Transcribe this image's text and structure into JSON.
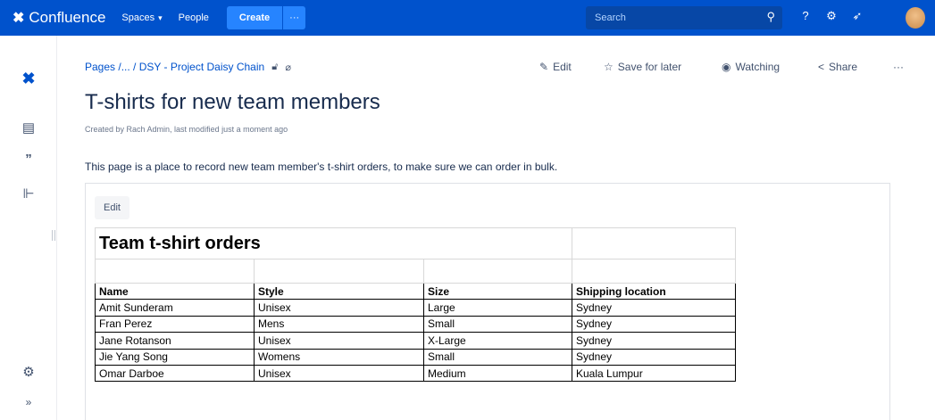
{
  "topnav": {
    "product": "Confluence",
    "spaces_label": "Spaces",
    "people_label": "People",
    "create_label": "Create",
    "more_label": "···",
    "search_placeholder": "Search"
  },
  "breadcrumb": "Pages /... / DSY - Project Daisy Chain",
  "actions": {
    "edit": "Edit",
    "save_for_later": "Save for later",
    "watching": "Watching",
    "share": "Share",
    "more": "···"
  },
  "page": {
    "title": "T-shirts for new team members",
    "byline": "Created by Rach Admin, last modified just a moment ago",
    "intro": "This page is a place to record new team member's t-shirt orders, to make sure we can order in bulk."
  },
  "content": {
    "edit_button": "Edit",
    "sheet_title": "Team t-shirt orders",
    "columns": [
      "Name",
      "Style",
      "Size",
      "Shipping location"
    ],
    "rows": [
      [
        "Amit Sunderam",
        "Unisex",
        "Large",
        "Sydney"
      ],
      [
        "Fran Perez",
        "Mens",
        "Small",
        "Sydney"
      ],
      [
        "Jane Rotanson",
        "Unisex",
        "X-Large",
        "Sydney"
      ],
      [
        "Jie Yang Song",
        "Womens",
        "Small",
        "Sydney"
      ],
      [
        "Omar Darboe",
        "Unisex",
        "Medium",
        "Kuala Lumpur"
      ]
    ]
  },
  "colors": {
    "nav_bg": "#0052CC",
    "create_bg": "#2684FF",
    "search_bg": "#0747A6",
    "link": "#0052CC"
  }
}
